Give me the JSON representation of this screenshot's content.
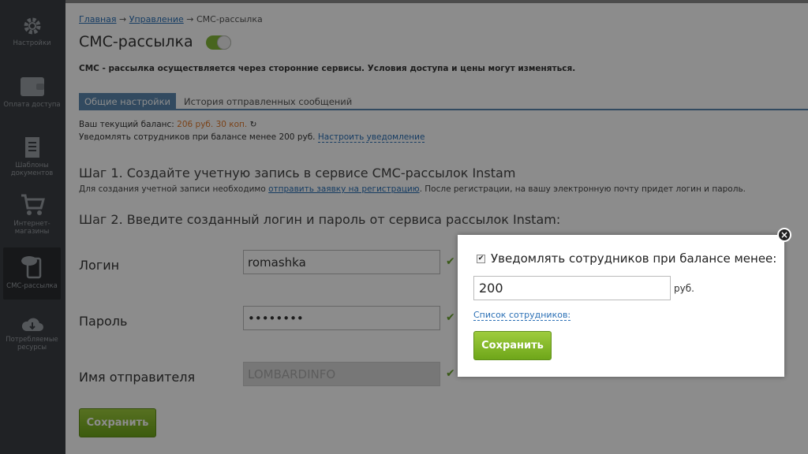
{
  "sidebar": {
    "items": [
      {
        "label": "Настройки",
        "icon": "gear-icon"
      },
      {
        "label": "Оплата доступа",
        "icon": "wallet-icon"
      },
      {
        "label": "Шаблоны документов",
        "icon": "document-icon"
      },
      {
        "label": "Интернет-магазины",
        "icon": "cart-icon"
      },
      {
        "label": "СМС-рассылка",
        "icon": "sms-phone-icon"
      },
      {
        "label": "Потребляемые ресурсы",
        "icon": "cloud-icon"
      }
    ]
  },
  "breadcrumb": {
    "home": "Главная",
    "sep": "→",
    "manage": "Управление",
    "current": "СМС-рассылка"
  },
  "page": {
    "title": "СМС-рассылка",
    "intro": "СМС - рассылка осуществляется через сторонние сервисы. Условия доступа и цены могут изменяться."
  },
  "tabs": {
    "active": "Общие настройки",
    "other": "История отправленных сообщений"
  },
  "balance": {
    "label": "Ваш текущий баланс:",
    "value": "206 руб. 30 коп.",
    "notify_text": "Уведомлять сотрудников при балансе менее 200 руб.",
    "notify_link": "Настроить уведомление"
  },
  "step1": {
    "title": "Шаг 1. Создайте учетную запись в сервисе СМС-рассылок Instam",
    "note_before": "Для создания учетной записи необходимо",
    "note_link": "отправить заявку на регистрацию",
    "note_after": ". После регистрации, на вашу электронную почту придет логин и пароль."
  },
  "step2": {
    "title": "Шаг 2. Введите созданный логин и пароль от сервиса рассылок Instam:"
  },
  "form": {
    "login_label": "Логин",
    "login_value": "romashka",
    "password_label": "Пароль",
    "password_value": "••••••••",
    "sender_label": "Имя отправителя",
    "sender_value": "LOMBARDINFO",
    "save": "Сохранить"
  },
  "popup": {
    "checkbox_label": "Уведомлять сотрудников при балансе менее:",
    "amount": "200",
    "unit": "руб.",
    "employees_link": "Список сотрудников:",
    "save": "Сохранить",
    "close": "×"
  }
}
